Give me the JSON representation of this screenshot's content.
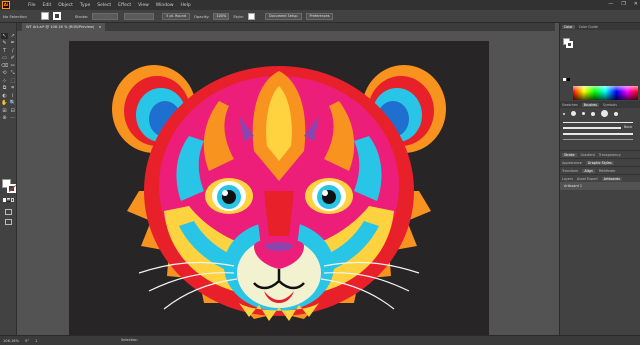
{
  "menubar": {
    "app_logo": "Ai",
    "items": [
      "File",
      "Edit",
      "Object",
      "Type",
      "Select",
      "Effect",
      "View",
      "Window",
      "Help"
    ],
    "window_controls": [
      "—",
      "❐",
      "✕"
    ]
  },
  "controlbar": {
    "selection_label": "No Selection",
    "stroke_label": "Stroke:",
    "brush_label": "5 pt. Round",
    "opacity_label": "Opacity:",
    "opacity_value": "100%",
    "style_label": "Style:",
    "document_setup_label": "Document Setup",
    "preferences_label": "Preferences"
  },
  "document_tab": {
    "title": "WT Art.ai* @ 106.16 % (RGB/Preview)",
    "close_glyph": "×"
  },
  "tools": [
    "↖",
    "↗",
    "✎",
    "✒",
    "T",
    "/",
    "▭",
    "✐",
    "⌫",
    "✂",
    "⟲",
    "⤡",
    "⊹",
    "⬚",
    "⧉",
    "⌗",
    "◐",
    "⌇",
    "✋",
    "🔍",
    "⊞",
    "⊟",
    "⊕",
    "⋯"
  ],
  "right_panel": {
    "color_tabs": [
      "Color",
      "Color Guide"
    ],
    "brush_tabs": [
      "Swatches",
      "Brushes",
      "Symbols"
    ],
    "brush_size_label": "Basic",
    "stack_rows": [
      [
        "Stroke",
        "Gradient",
        "Transparency"
      ],
      [
        "Appearance",
        "Graphic Styles"
      ],
      [
        "Transform",
        "Align",
        "Pathfinder"
      ],
      [
        "Layers",
        "Asset Export",
        "Artboards"
      ]
    ],
    "artboard_row": "Artboard 1"
  },
  "statusbar": {
    "zoom": "106.16%",
    "rotation": "0°",
    "artboard_nav": "1",
    "tool_status": "Selection"
  },
  "artwork": {
    "subject": "colorful-tiger-cub-illustration",
    "colors": {
      "background": "#282527",
      "orange": "#f7931e",
      "red": "#e8202a",
      "pink": "#ec1e79",
      "cyan": "#29c5e6",
      "yellow": "#ffd23f",
      "purple": "#8e44ad",
      "blue": "#1f6fd1"
    }
  }
}
